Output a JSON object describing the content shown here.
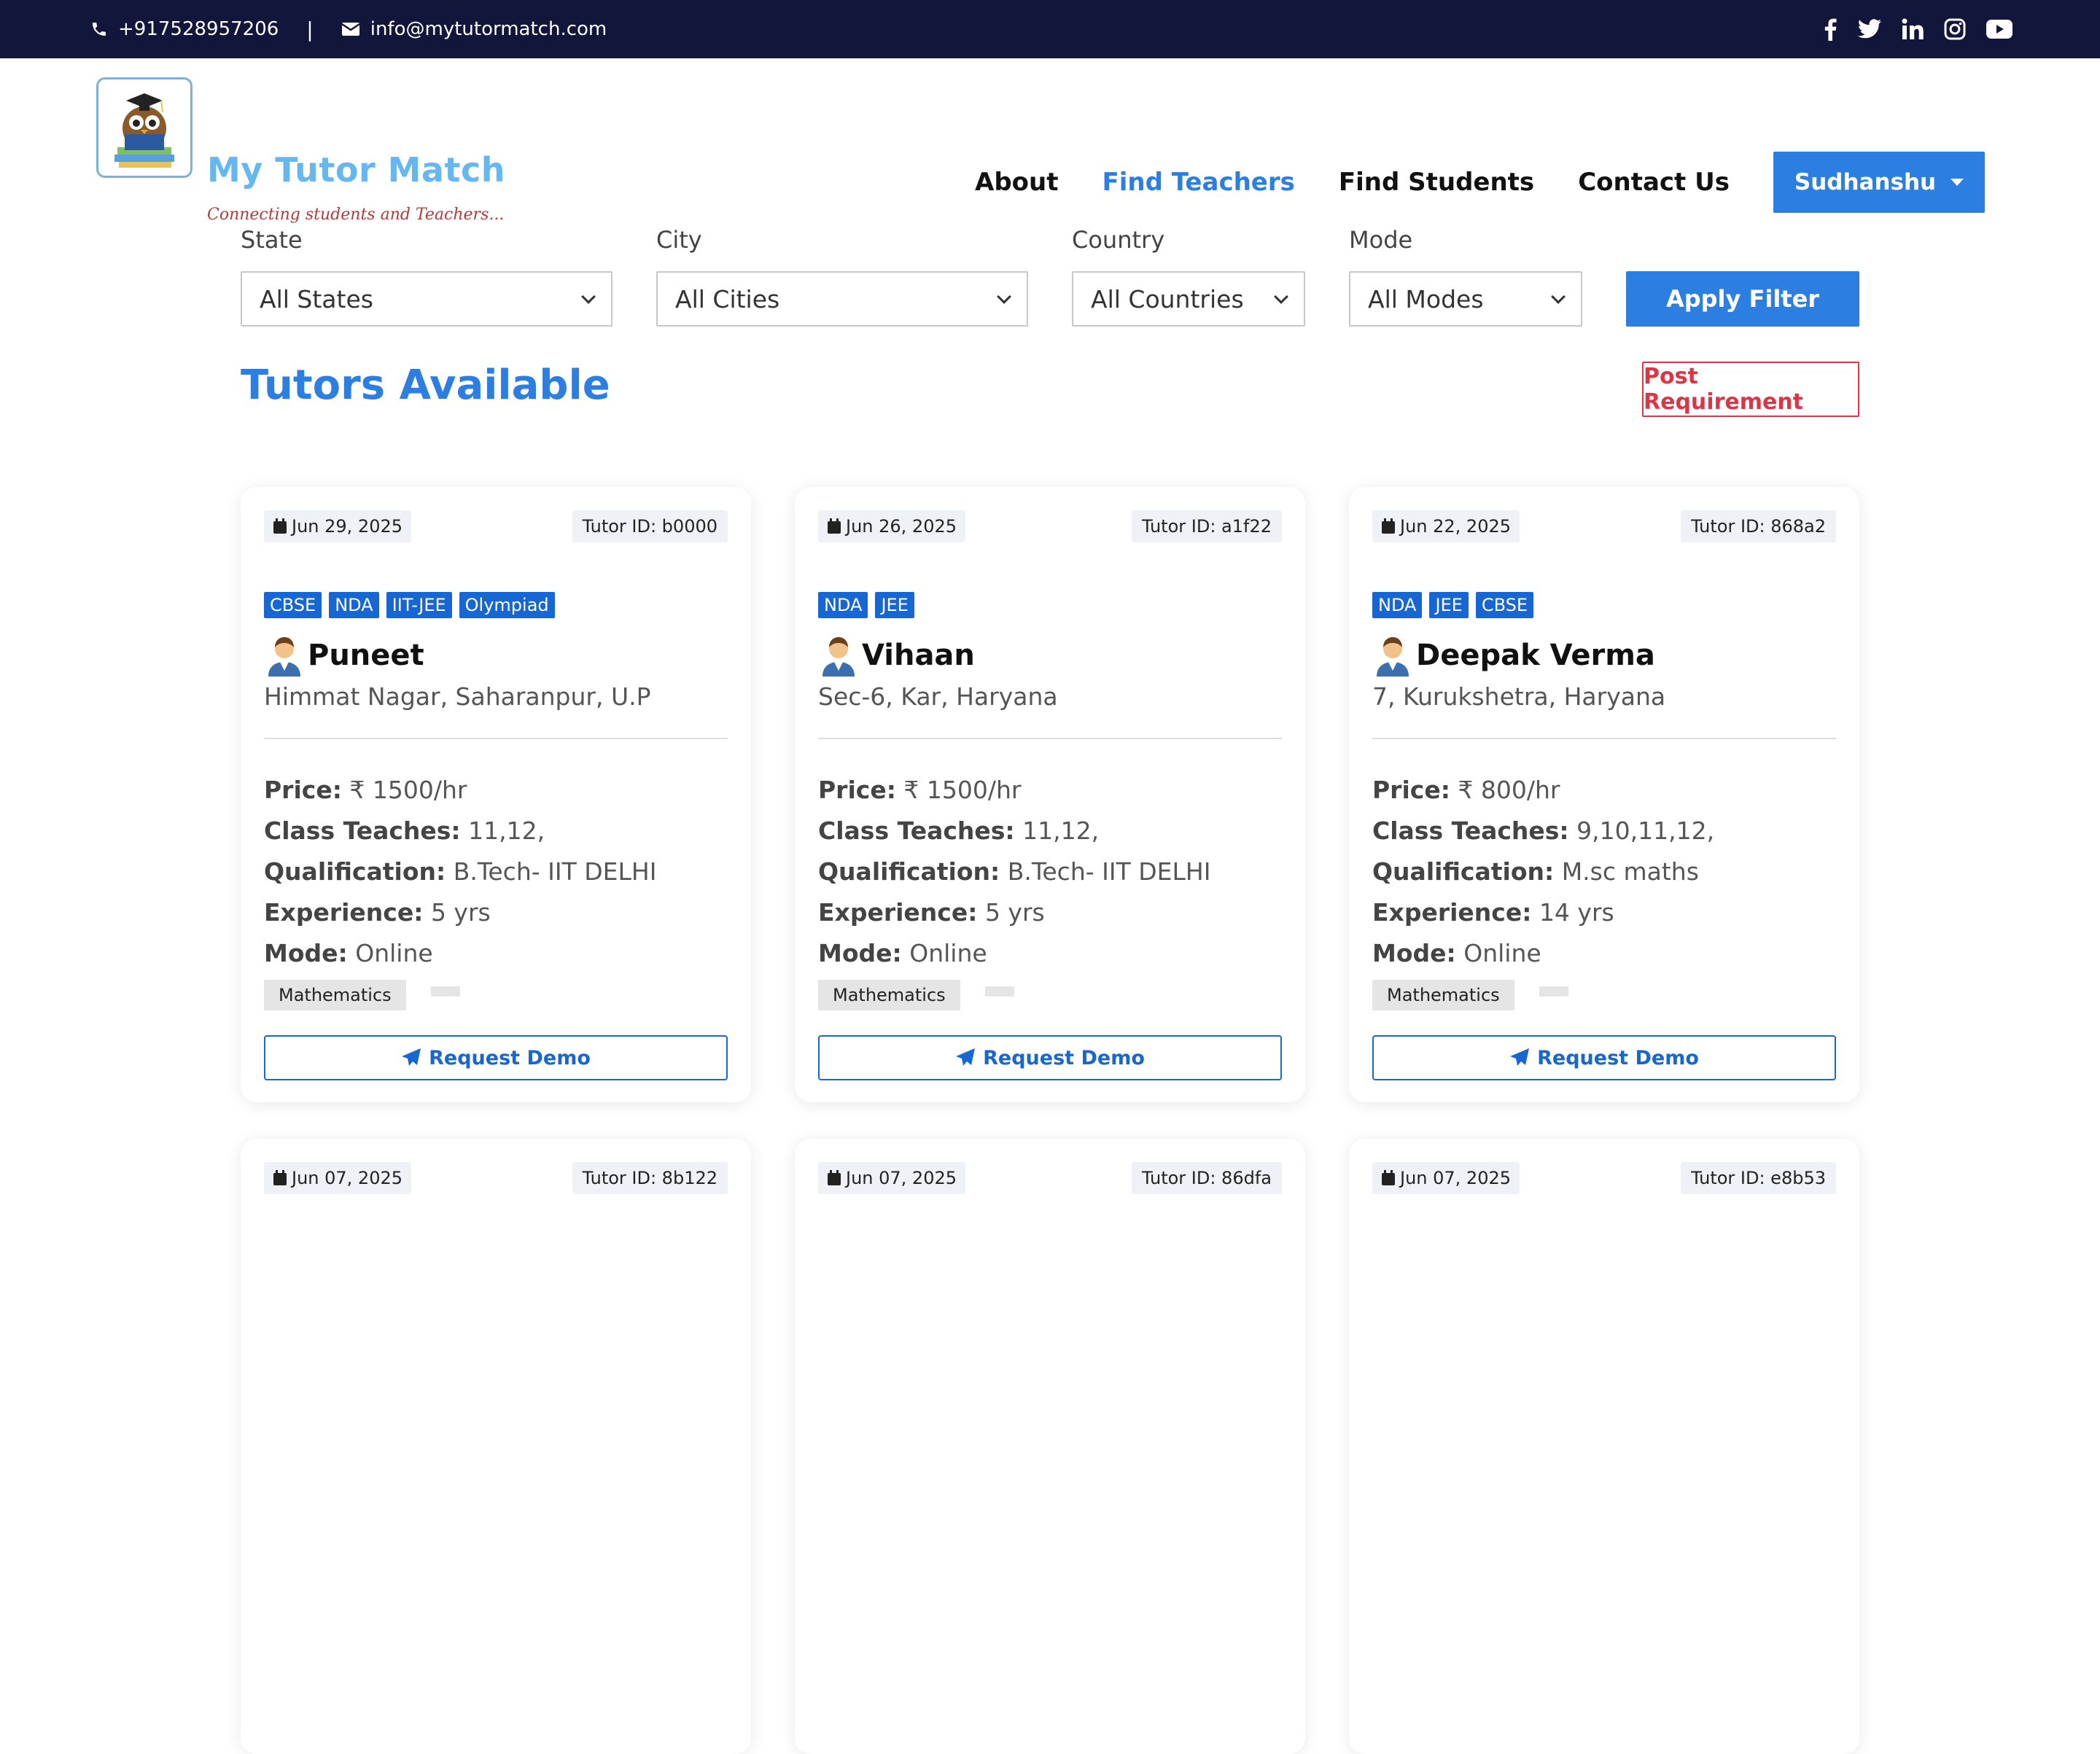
{
  "topbar": {
    "phone": "+917528957206",
    "separator": "|",
    "email": "info@mytutormatch.com",
    "social_icons": [
      "facebook-icon",
      "twitter-icon",
      "linkedin-icon",
      "instagram-icon",
      "youtube-icon"
    ]
  },
  "brand": {
    "title": "My Tutor Match",
    "tagline": "Connecting students and Teachers..."
  },
  "nav": {
    "items": [
      {
        "label": "About"
      },
      {
        "label": "Find Teachers"
      },
      {
        "label": "Find Students"
      },
      {
        "label": "Contact Us"
      }
    ],
    "user_label": "Sudhanshu"
  },
  "filters": {
    "state": {
      "label": "State",
      "value": "All States"
    },
    "city": {
      "label": "City",
      "value": "All Cities"
    },
    "country": {
      "label": "Country",
      "value": "All Countries"
    },
    "mode": {
      "label": "Mode",
      "value": "All Modes"
    },
    "apply_label": "Apply Filter"
  },
  "section": {
    "title": "Tutors Available",
    "post_label": "Post Requirement"
  },
  "labels": {
    "price": "Price:",
    "class": "Class Teaches:",
    "qualification": "Qualification:",
    "experience": "Experience:",
    "mode": "Mode:",
    "request_demo": "Request Demo"
  },
  "tutors": [
    {
      "date": "Jun 29, 2025",
      "id": "Tutor ID: b0000",
      "tags": [
        "CBSE",
        "NDA",
        "IIT-JEE",
        "Olympiad"
      ],
      "name": "Puneet",
      "address": "Himmat Nagar, Saharanpur, U.P",
      "price": "₹ 1500/hr",
      "class": "11,12,",
      "qualification": "B.Tech- IIT DELHI",
      "experience": "5 yrs",
      "mode": "Online",
      "subject": "Mathematics"
    },
    {
      "date": "Jun 26, 2025",
      "id": "Tutor ID: a1f22",
      "tags": [
        "NDA",
        "JEE"
      ],
      "name": "Vihaan",
      "address": "Sec-6, Kar, Haryana",
      "price": "₹ 1500/hr",
      "class": "11,12,",
      "qualification": "B.Tech- IIT DELHI",
      "experience": "5 yrs",
      "mode": "Online",
      "subject": "Mathematics"
    },
    {
      "date": "Jun 22, 2025",
      "id": "Tutor ID: 868a2",
      "tags": [
        "NDA",
        "JEE",
        "CBSE"
      ],
      "name": "Deepak Verma",
      "address": "7, Kurukshetra, Haryana",
      "price": "₹ 800/hr",
      "class": "9,10,11,12,",
      "qualification": "M.sc maths",
      "experience": "14 yrs",
      "mode": "Online",
      "subject": "Mathematics"
    },
    {
      "date": "Jun 07, 2025",
      "id": "Tutor ID: 8b122"
    },
    {
      "date": "Jun 07, 2025",
      "id": "Tutor ID: 86dfa"
    },
    {
      "date": "Jun 07, 2025",
      "id": "Tutor ID: e8b53"
    }
  ]
}
